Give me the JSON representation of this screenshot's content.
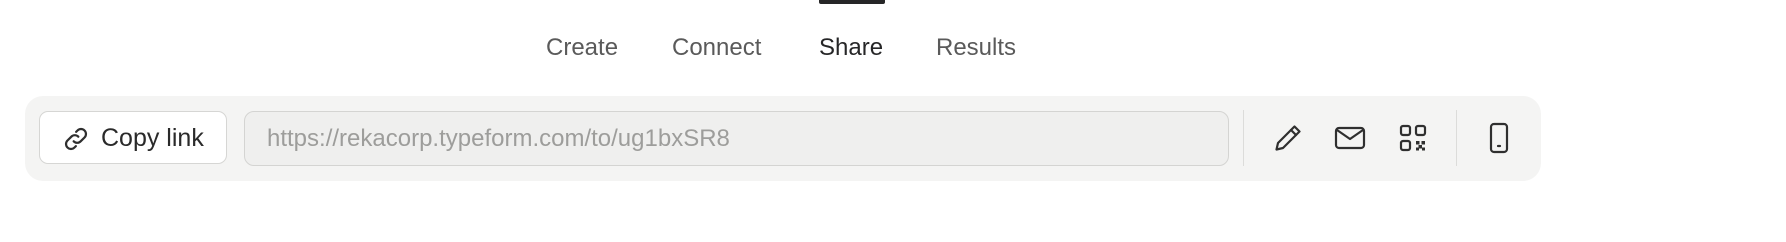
{
  "tabs": [
    {
      "label": "Create",
      "active": false
    },
    {
      "label": "Connect",
      "active": false
    },
    {
      "label": "Share",
      "active": true
    },
    {
      "label": "Results",
      "active": false
    }
  ],
  "share": {
    "copy_link_label": "Copy link",
    "copy_link_icon": "link-icon",
    "url_value": "https://rekacorp.typeform.com/to/ug1bxSR8",
    "actions": [
      {
        "name": "edit-link-button",
        "icon": "pencil-icon"
      },
      {
        "name": "email-share-button",
        "icon": "envelope-icon"
      },
      {
        "name": "qr-code-button",
        "icon": "qr-code-icon"
      },
      {
        "name": "mobile-preview-button",
        "icon": "mobile-phone-icon"
      }
    ]
  },
  "colors": {
    "active_tab": "#262627",
    "inactive_tab": "#5a5a5a",
    "toolbar_bg": "#f4f4f3",
    "url_text": "#9d9d9b"
  }
}
